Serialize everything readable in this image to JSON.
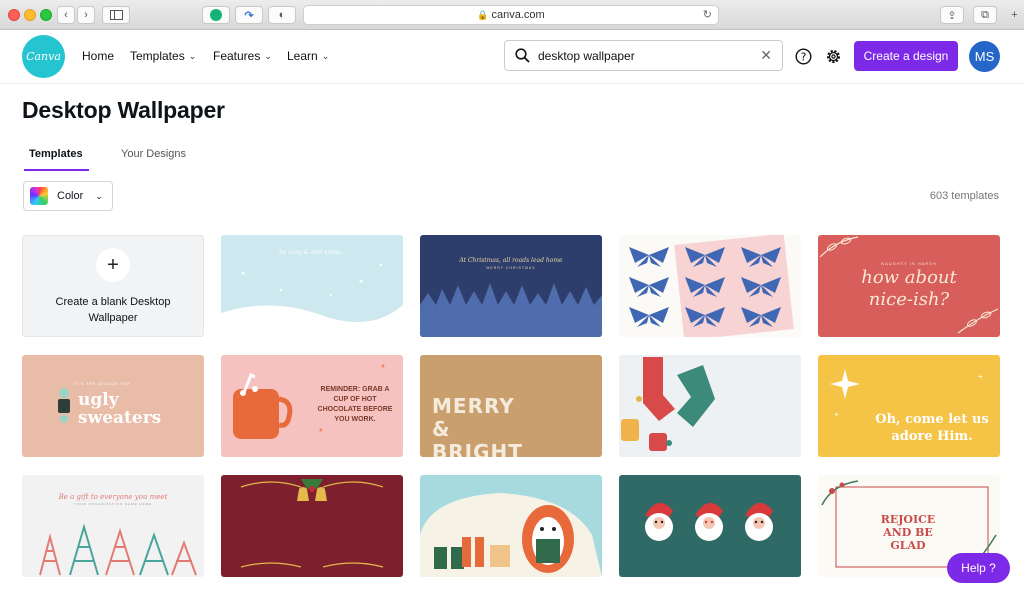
{
  "browser": {
    "url": "canva.com"
  },
  "header": {
    "logo": "Canva",
    "nav": [
      {
        "label": "Home"
      },
      {
        "label": "Templates"
      },
      {
        "label": "Features"
      },
      {
        "label": "Learn"
      }
    ],
    "search": {
      "value": "desktop wallpaper"
    },
    "create_label": "Create a design",
    "avatar_initials": "MS"
  },
  "page": {
    "title": "Desktop Wallpaper",
    "tabs": [
      {
        "label": "Templates",
        "active": true
      },
      {
        "label": "Your Designs",
        "active": false
      }
    ],
    "filter_label": "Color",
    "template_count": "603 templates"
  },
  "blank_card": {
    "label": "Create a blank Desktop Wallpaper"
  },
  "templates": [
    {
      "bg": "#cde8ee",
      "text": "be cozy & and snow..."
    },
    {
      "bg": "#2d3d6c",
      "text": "At Christmas, all roads lead home",
      "subtext": "MERRY CHRISTMAS"
    },
    {
      "bg": "#fbfaf6",
      "text": ""
    },
    {
      "bg": "#d75e5b",
      "text": "how about nice-ish?",
      "subtext": "NAUGHTY IS HARSH"
    },
    {
      "bg": "#e8bca7",
      "text": "ugly sweaters",
      "subtext": "IT'S THE SEASON FOR"
    },
    {
      "bg": "#f6c2c0",
      "text": "REMINDER: GRAB A CUP OF HOT CHOCOLATE BEFORE YOU WORK."
    },
    {
      "bg": "#c99f6e",
      "text": "MERRY & BRIGHT"
    },
    {
      "bg": "#eef1f3",
      "text": ""
    },
    {
      "bg": "#f5c346",
      "text": "Oh, come let us adore Him."
    },
    {
      "bg": "#f2f2f3",
      "text": "Be a gift to everyone you meet",
      "subtext": "YOUR ORGANIZATION NAME HERE"
    },
    {
      "bg": "#7e1f2e",
      "text": ""
    },
    {
      "bg": "#a6dadf",
      "text": ""
    },
    {
      "bg": "#2f6a67",
      "text": ""
    },
    {
      "bg": "#fbfaf4",
      "text": "REJOICE AND BE GLAD"
    }
  ],
  "help_label": "Help  ?",
  "colors": {
    "accent": "#7d2ae8",
    "logo": "#24c4d1",
    "avatar": "#2566c8"
  }
}
